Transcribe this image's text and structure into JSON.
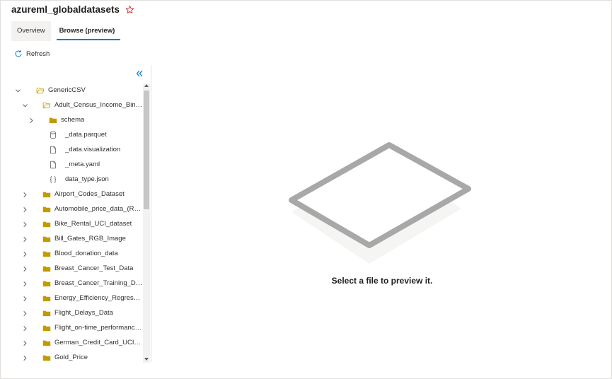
{
  "header": {
    "title": "azureml_globaldatasets",
    "favorite_icon": "star-outline-icon"
  },
  "tabs": [
    {
      "label": "Overview",
      "active": false
    },
    {
      "label": "Browse (preview)",
      "active": true
    }
  ],
  "toolbar": {
    "refresh_label": "Refresh"
  },
  "tree": {
    "collapse_icon": "double-chevron-left-icon",
    "items": [
      {
        "label": "GenericCSV",
        "icon": "folder-open-icon",
        "expanded": true
      },
      {
        "label": "Adult_Census_Income_Binar...",
        "icon": "folder-open-icon",
        "expanded": true
      },
      {
        "label": "schema",
        "icon": "folder-icon",
        "expanded": false
      },
      {
        "label": "_data.parquet",
        "icon": "database-icon"
      },
      {
        "label": "_data.visualization",
        "icon": "file-icon"
      },
      {
        "label": "_meta.yaml",
        "icon": "file-icon"
      },
      {
        "label": "data_type.json",
        "icon": "braces-icon"
      },
      {
        "label": "Airport_Codes_Dataset",
        "icon": "folder-icon",
        "expanded": false
      },
      {
        "label": "Automobile_price_data_(Raw)",
        "icon": "folder-icon",
        "expanded": false
      },
      {
        "label": "Bike_Rental_UCI_dataset",
        "icon": "folder-icon",
        "expanded": false
      },
      {
        "label": "Bill_Gates_RGB_Image",
        "icon": "folder-icon",
        "expanded": false
      },
      {
        "label": "Blood_donation_data",
        "icon": "folder-icon",
        "expanded": false
      },
      {
        "label": "Breast_Cancer_Test_Data",
        "icon": "folder-icon",
        "expanded": false
      },
      {
        "label": "Breast_Cancer_Training_Data",
        "icon": "folder-icon",
        "expanded": false
      },
      {
        "label": "Energy_Efficiency_Regressio...",
        "icon": "folder-icon",
        "expanded": false
      },
      {
        "label": "Flight_Delays_Data",
        "icon": "folder-icon",
        "expanded": false
      },
      {
        "label": "Flight_on-time_performance...",
        "icon": "folder-icon",
        "expanded": false
      },
      {
        "label": "German_Credit_Card_UCI_da...",
        "icon": "folder-icon",
        "expanded": false
      },
      {
        "label": "Gold_Price",
        "icon": "folder-icon",
        "expanded": false
      }
    ]
  },
  "preview": {
    "empty_message": "Select a file to preview it.",
    "illustration_icon": "empty-tablet-icon"
  },
  "colors": {
    "accent": "#0078d4",
    "folder": "#c19c00",
    "star": "#d13438"
  }
}
